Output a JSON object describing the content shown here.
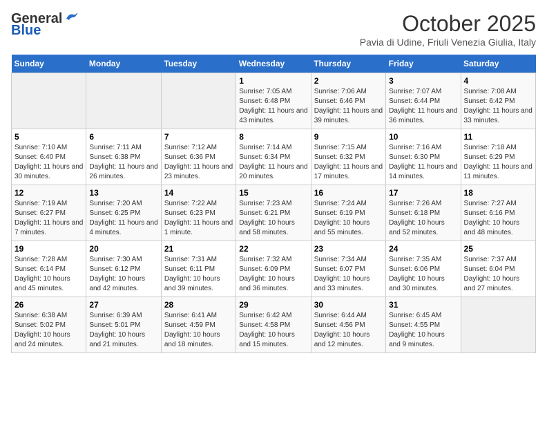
{
  "header": {
    "logo_general": "General",
    "logo_blue": "Blue",
    "title": "October 2025",
    "subtitle": "Pavia di Udine, Friuli Venezia Giulia, Italy"
  },
  "weekdays": [
    "Sunday",
    "Monday",
    "Tuesday",
    "Wednesday",
    "Thursday",
    "Friday",
    "Saturday"
  ],
  "weeks": [
    [
      {
        "day": "",
        "info": ""
      },
      {
        "day": "",
        "info": ""
      },
      {
        "day": "",
        "info": ""
      },
      {
        "day": "1",
        "info": "Sunrise: 7:05 AM\nSunset: 6:48 PM\nDaylight: 11 hours and 43 minutes."
      },
      {
        "day": "2",
        "info": "Sunrise: 7:06 AM\nSunset: 6:46 PM\nDaylight: 11 hours and 39 minutes."
      },
      {
        "day": "3",
        "info": "Sunrise: 7:07 AM\nSunset: 6:44 PM\nDaylight: 11 hours and 36 minutes."
      },
      {
        "day": "4",
        "info": "Sunrise: 7:08 AM\nSunset: 6:42 PM\nDaylight: 11 hours and 33 minutes."
      }
    ],
    [
      {
        "day": "5",
        "info": "Sunrise: 7:10 AM\nSunset: 6:40 PM\nDaylight: 11 hours and 30 minutes."
      },
      {
        "day": "6",
        "info": "Sunrise: 7:11 AM\nSunset: 6:38 PM\nDaylight: 11 hours and 26 minutes."
      },
      {
        "day": "7",
        "info": "Sunrise: 7:12 AM\nSunset: 6:36 PM\nDaylight: 11 hours and 23 minutes."
      },
      {
        "day": "8",
        "info": "Sunrise: 7:14 AM\nSunset: 6:34 PM\nDaylight: 11 hours and 20 minutes."
      },
      {
        "day": "9",
        "info": "Sunrise: 7:15 AM\nSunset: 6:32 PM\nDaylight: 11 hours and 17 minutes."
      },
      {
        "day": "10",
        "info": "Sunrise: 7:16 AM\nSunset: 6:30 PM\nDaylight: 11 hours and 14 minutes."
      },
      {
        "day": "11",
        "info": "Sunrise: 7:18 AM\nSunset: 6:29 PM\nDaylight: 11 hours and 11 minutes."
      }
    ],
    [
      {
        "day": "12",
        "info": "Sunrise: 7:19 AM\nSunset: 6:27 PM\nDaylight: 11 hours and 7 minutes."
      },
      {
        "day": "13",
        "info": "Sunrise: 7:20 AM\nSunset: 6:25 PM\nDaylight: 11 hours and 4 minutes."
      },
      {
        "day": "14",
        "info": "Sunrise: 7:22 AM\nSunset: 6:23 PM\nDaylight: 11 hours and 1 minute."
      },
      {
        "day": "15",
        "info": "Sunrise: 7:23 AM\nSunset: 6:21 PM\nDaylight: 10 hours and 58 minutes."
      },
      {
        "day": "16",
        "info": "Sunrise: 7:24 AM\nSunset: 6:19 PM\nDaylight: 10 hours and 55 minutes."
      },
      {
        "day": "17",
        "info": "Sunrise: 7:26 AM\nSunset: 6:18 PM\nDaylight: 10 hours and 52 minutes."
      },
      {
        "day": "18",
        "info": "Sunrise: 7:27 AM\nSunset: 6:16 PM\nDaylight: 10 hours and 48 minutes."
      }
    ],
    [
      {
        "day": "19",
        "info": "Sunrise: 7:28 AM\nSunset: 6:14 PM\nDaylight: 10 hours and 45 minutes."
      },
      {
        "day": "20",
        "info": "Sunrise: 7:30 AM\nSunset: 6:12 PM\nDaylight: 10 hours and 42 minutes."
      },
      {
        "day": "21",
        "info": "Sunrise: 7:31 AM\nSunset: 6:11 PM\nDaylight: 10 hours and 39 minutes."
      },
      {
        "day": "22",
        "info": "Sunrise: 7:32 AM\nSunset: 6:09 PM\nDaylight: 10 hours and 36 minutes."
      },
      {
        "day": "23",
        "info": "Sunrise: 7:34 AM\nSunset: 6:07 PM\nDaylight: 10 hours and 33 minutes."
      },
      {
        "day": "24",
        "info": "Sunrise: 7:35 AM\nSunset: 6:06 PM\nDaylight: 10 hours and 30 minutes."
      },
      {
        "day": "25",
        "info": "Sunrise: 7:37 AM\nSunset: 6:04 PM\nDaylight: 10 hours and 27 minutes."
      }
    ],
    [
      {
        "day": "26",
        "info": "Sunrise: 6:38 AM\nSunset: 5:02 PM\nDaylight: 10 hours and 24 minutes."
      },
      {
        "day": "27",
        "info": "Sunrise: 6:39 AM\nSunset: 5:01 PM\nDaylight: 10 hours and 21 minutes."
      },
      {
        "day": "28",
        "info": "Sunrise: 6:41 AM\nSunset: 4:59 PM\nDaylight: 10 hours and 18 minutes."
      },
      {
        "day": "29",
        "info": "Sunrise: 6:42 AM\nSunset: 4:58 PM\nDaylight: 10 hours and 15 minutes."
      },
      {
        "day": "30",
        "info": "Sunrise: 6:44 AM\nSunset: 4:56 PM\nDaylight: 10 hours and 12 minutes."
      },
      {
        "day": "31",
        "info": "Sunrise: 6:45 AM\nSunset: 4:55 PM\nDaylight: 10 hours and 9 minutes."
      },
      {
        "day": "",
        "info": ""
      }
    ]
  ]
}
